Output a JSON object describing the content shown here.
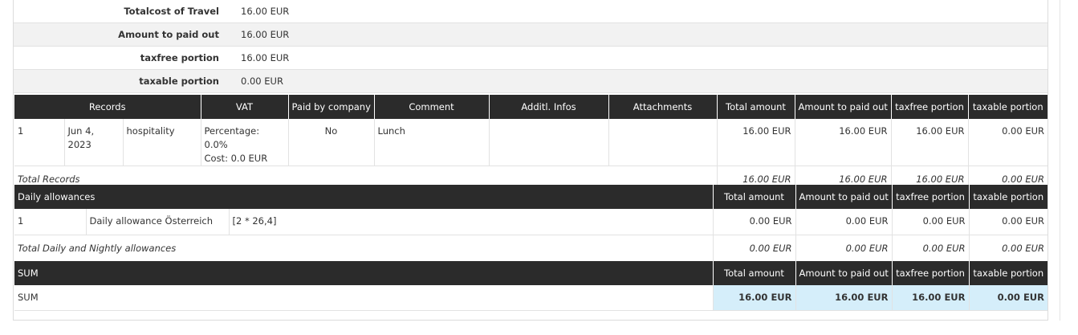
{
  "summary": [
    {
      "label": "Totalcost of Travel",
      "value": "16.00 EUR"
    },
    {
      "label": "Amount to paid out",
      "value": "16.00 EUR"
    },
    {
      "label": "taxfree portion",
      "value": "16.00 EUR"
    },
    {
      "label": "taxable portion",
      "value": "0.00 EUR"
    }
  ],
  "records": {
    "headers": [
      "Records",
      "VAT",
      "Paid by company",
      "Comment",
      "Additl. Infos",
      "Attachments",
      "Total amount",
      "Amount to paid out",
      "taxfree portion",
      "taxable portion"
    ],
    "rows": [
      {
        "no": "1",
        "date": "Jun 4, 2023",
        "category": "hospitality",
        "vat_percentage": "Percentage:  0.0%",
        "vat_cost": "Cost: 0.0 EUR",
        "paid_by_company": "No",
        "comment": "Lunch",
        "additional_infos": "",
        "attachments": "",
        "total_amount": "16.00 EUR",
        "amount_paid_out": "16.00 EUR",
        "taxfree": "16.00 EUR",
        "taxable": "0.00 EUR"
      }
    ],
    "total": {
      "label": "Total Records",
      "total_amount": "16.00 EUR",
      "amount_paid_out": "16.00 EUR",
      "taxfree": "16.00 EUR",
      "taxable": "0.00 EUR"
    }
  },
  "allowances": {
    "headers": [
      "Daily allowances",
      "Total amount",
      "Amount to paid out",
      "taxfree portion",
      "taxable portion"
    ],
    "rows": [
      {
        "no": "1",
        "name": "Daily allowance Österreich",
        "formula": "[2 * 26,4]",
        "total_amount": "0.00 EUR",
        "amount_paid_out": "0.00 EUR",
        "taxfree": "0.00 EUR",
        "taxable": "0.00 EUR"
      }
    ],
    "total": {
      "label": "Total Daily and Nightly allowances",
      "total_amount": "0.00 EUR",
      "amount_paid_out": "0.00 EUR",
      "taxfree": "0.00 EUR",
      "taxable": "0.00 EUR"
    }
  },
  "sum": {
    "headers": [
      "SUM",
      "Total amount",
      "Amount to paid out",
      "taxfree portion",
      "taxable portion"
    ],
    "row": {
      "label": "SUM",
      "total_amount": "16.00 EUR",
      "amount_paid_out": "16.00 EUR",
      "taxfree": "16.00 EUR",
      "taxable": "0.00 EUR"
    }
  },
  "colors": {
    "header_bg": "#2b2b2b",
    "highlight_bg": "#d5eefa",
    "stripe_bg": "#f2f2f2"
  }
}
